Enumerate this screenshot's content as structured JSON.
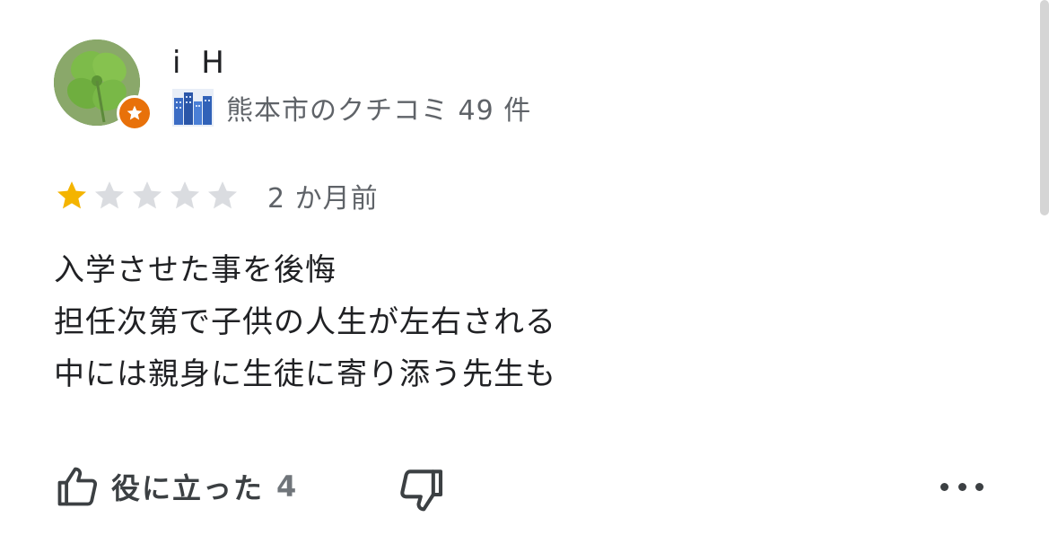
{
  "author": {
    "name": "i H",
    "avatar_icon": "clover-avatar",
    "badge_icon": "local-guide-star-icon",
    "badge_color": "#e8710a"
  },
  "guide": {
    "icon": "city-icon",
    "text": "熊本市のクチコミ 49 件"
  },
  "rating": {
    "value": 1,
    "max": 5,
    "filled_color": "#f4b400",
    "empty_color": "#dadce0"
  },
  "date": "2 か月前",
  "review": {
    "lines": [
      "入学させた事を後悔",
      "担任次第で子供の人生が左右される",
      "中には親身に生徒に寄り添う先生も"
    ]
  },
  "actions": {
    "helpful_label": "役に立った",
    "helpful_count": "4",
    "helpful_icon": "thumb-up-icon",
    "not_helpful_icon": "thumb-down-icon",
    "more_icon": "more-horizontal-icon"
  }
}
